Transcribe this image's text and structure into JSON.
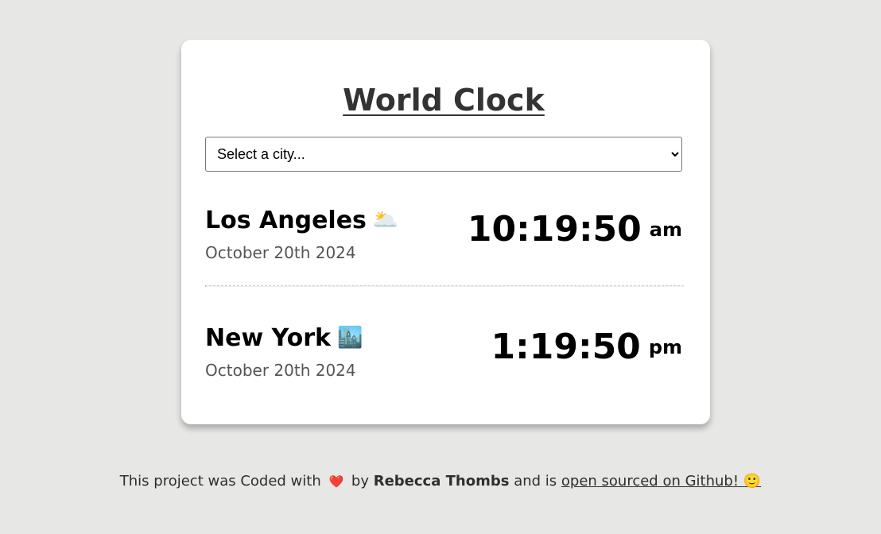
{
  "app": {
    "title": "World Clock"
  },
  "city_select": {
    "selected_label": "Select a city..."
  },
  "cities": [
    {
      "name": "Los Angeles",
      "emoji": "🌥️",
      "date": "October 20th 2024",
      "time": "10:19:50",
      "ampm": "am"
    },
    {
      "name": "New York",
      "emoji": "🏙️",
      "date": "October 20th 2024",
      "time": "1:19:50",
      "ampm": "pm"
    }
  ],
  "footer": {
    "prefix": "This project was Coded with",
    "heart": "❤️",
    "by": "by",
    "author": "Rebecca Thombs",
    "middle": "and is",
    "link_text": "open sourced on Github! 🙂"
  },
  "colors": {
    "background": "#e7e7e5",
    "card": "#ffffff",
    "text": "#2f2f2f"
  }
}
